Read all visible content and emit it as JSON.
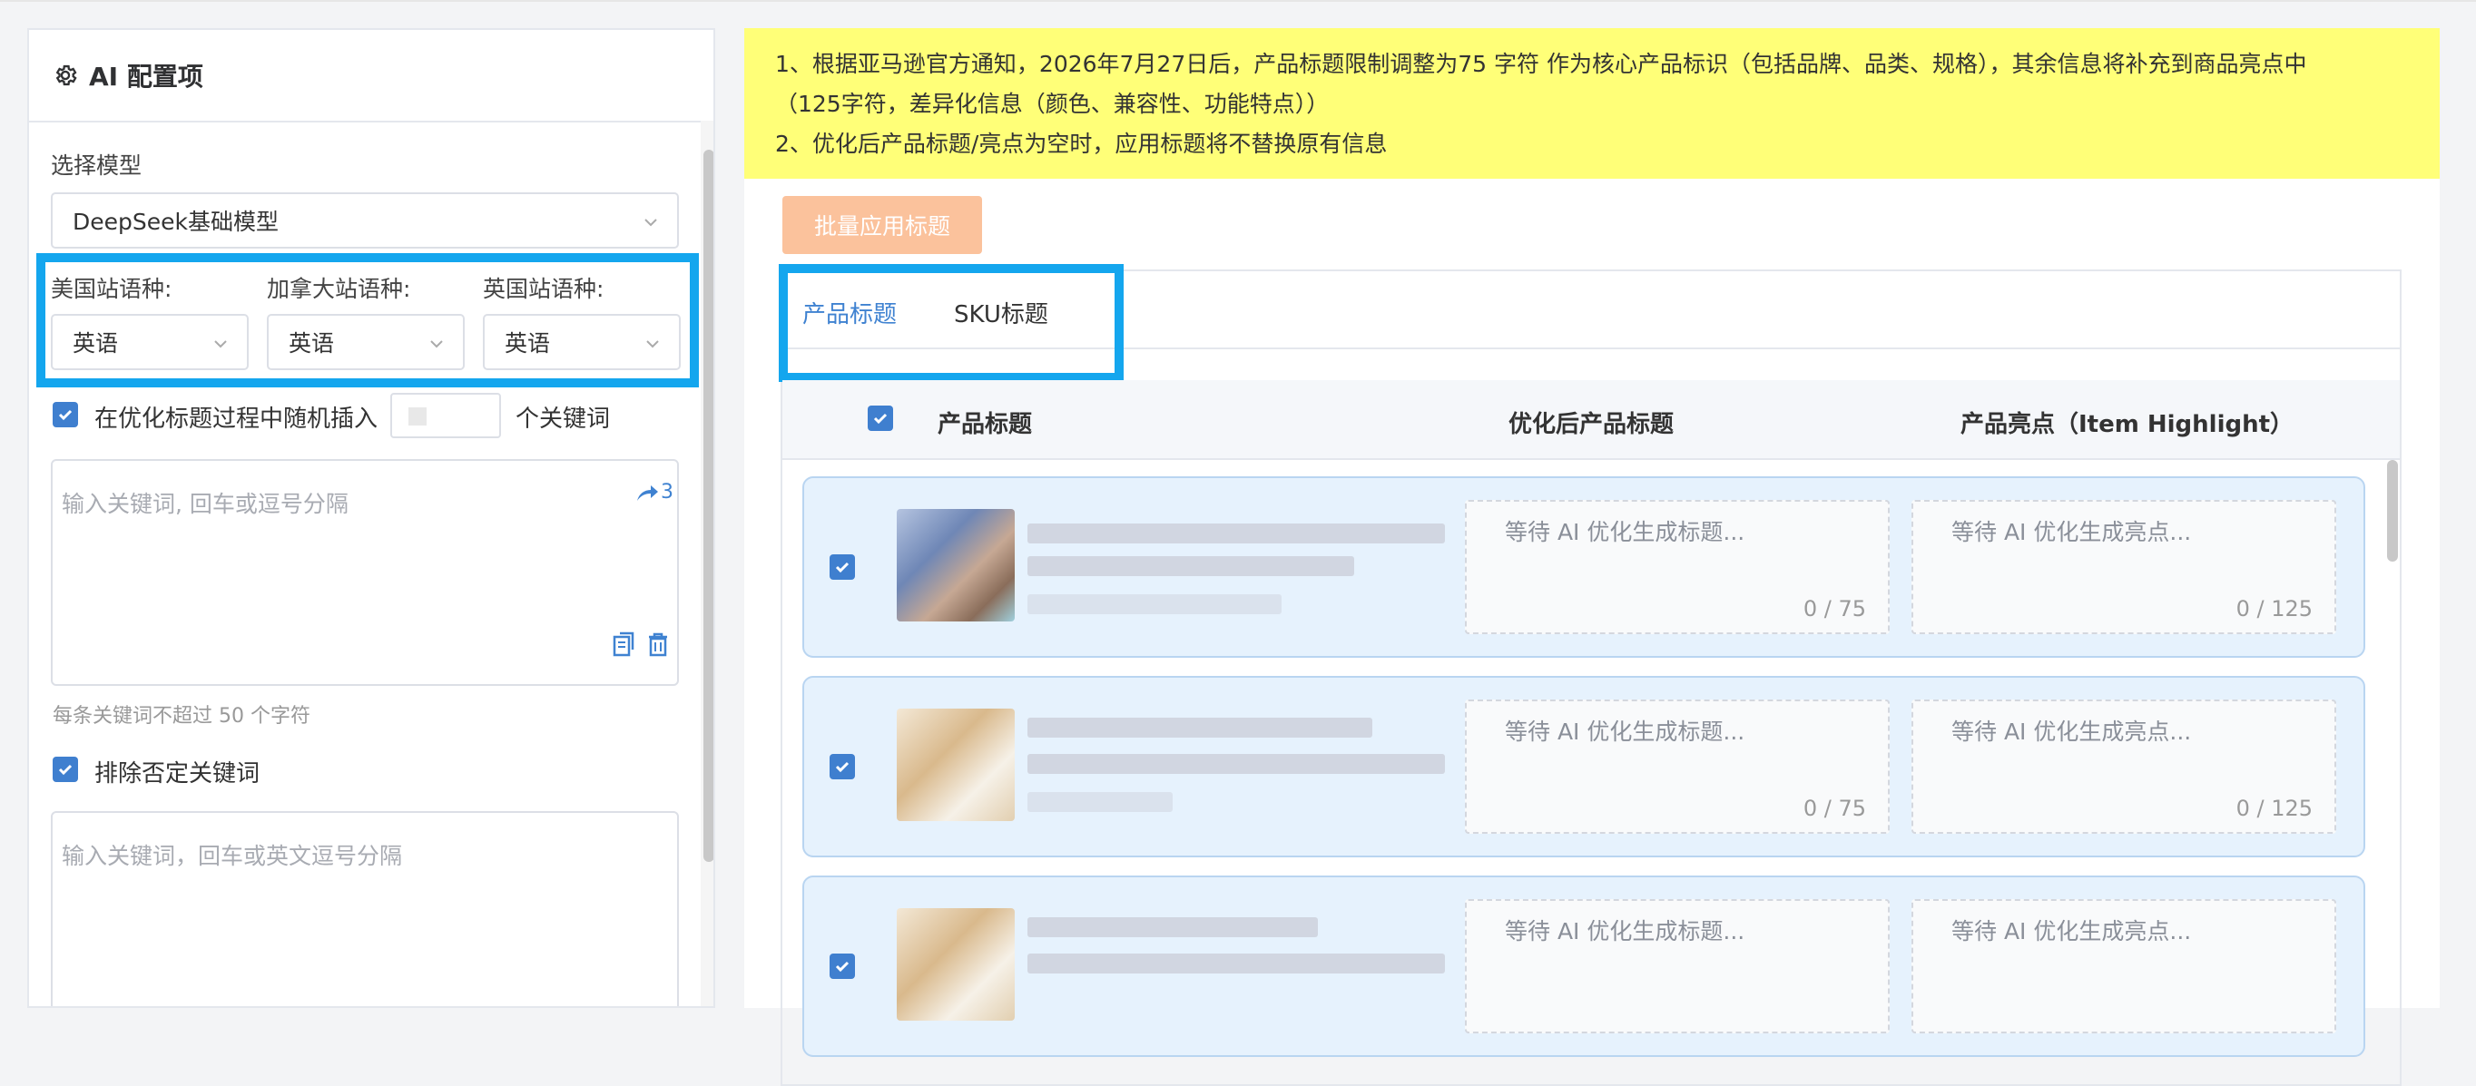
{
  "left_panel": {
    "title": "AI 配置项",
    "model_label": "选择模型",
    "model_value": "DeepSeek基础模型",
    "languages": [
      {
        "label": "美国站语种:",
        "value": "英语"
      },
      {
        "label": "加拿大站语种:",
        "value": "英语"
      },
      {
        "label": "英国站语种:",
        "value": "英语"
      }
    ],
    "random_insert": {
      "checked": true,
      "prefix": "在优化标题过程中随机插入",
      "suffix": "个关键词"
    },
    "keywords_placeholder": "输入关键词, 回车或逗号分隔",
    "keywords_badge": "3",
    "keyword_hint": "每条关键词不超过 50 个字符",
    "exclude_negative": {
      "checked": true,
      "label": "排除否定关键词"
    },
    "negative_placeholder": "输入关键词，回车或英文逗号分隔"
  },
  "notice": {
    "line1": "1、根据亚马逊官方通知，2026年7月27日后，产品标题限制调整为75 字符 作为核心产品标识（包括品牌、品类、规格），其余信息将补充到商品亮点中",
    "line2": "（125字符，差异化信息（颜色、兼容性、功能特点））",
    "line3": "2、优化后产品标题/亮点为空时，应用标题将不替换原有信息"
  },
  "batch_button": "批量应用标题",
  "tabs": [
    {
      "label": "产品标题",
      "active": true
    },
    {
      "label": "SKU标题",
      "active": false
    }
  ],
  "table": {
    "headers": {
      "product_title": "产品标题",
      "optimized_title": "优化后产品标题",
      "highlight": "产品亮点（Item Highlight）"
    },
    "rows": [
      {
        "checked": true,
        "title_placeholder": "等待 AI 优化生成标题...",
        "title_count": "0 / 75",
        "highlight_placeholder": "等待 AI 优化生成亮点...",
        "highlight_count": "0 / 125"
      },
      {
        "checked": true,
        "title_placeholder": "等待 AI 优化生成标题...",
        "title_count": "0 / 75",
        "highlight_placeholder": "等待 AI 优化生成亮点...",
        "highlight_count": "0 / 125"
      },
      {
        "checked": true,
        "title_placeholder": "等待 AI 优化生成标题...",
        "title_count": "",
        "highlight_placeholder": "等待 AI 优化生成亮点...",
        "highlight_count": ""
      }
    ]
  },
  "colors": {
    "accent": "#3f82d1",
    "highlight_box": "#14a6ee",
    "notice_bg": "#ffff78",
    "batch_button_bg": "#fbc29c",
    "row_bg": "#e6f2fd"
  }
}
